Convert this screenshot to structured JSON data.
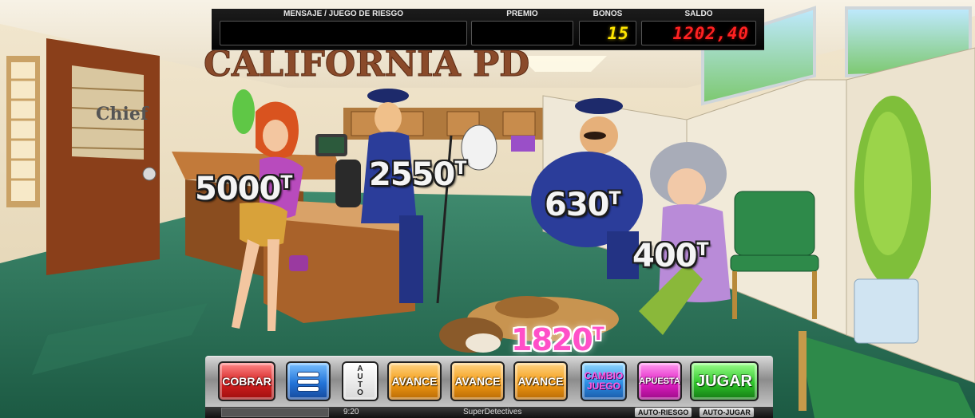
{
  "hud": {
    "mensaje_label": "MENSAJE / JUEGO DE RIESGO",
    "premio_label": "PREMIO",
    "bonos_label": "BONOS",
    "saldo_label": "SALDO",
    "bonos_value": "15",
    "saldo_value": "1202,40"
  },
  "scene": {
    "sign": "CALIFORNIA PD",
    "door_sign": "Chief"
  },
  "prizes": {
    "woman": "5000",
    "officer": "2550",
    "fat_officer": "630",
    "grandma": "400",
    "dog": "1820",
    "unit": "T"
  },
  "controls": {
    "cobrar": "COBRAR",
    "auto_letters": [
      "A",
      "U",
      "T",
      "O"
    ],
    "avance": "AVANCE",
    "cambio_line1": "CAMBIO",
    "cambio_line2": "JUEGO",
    "apuesta": "APUESTA",
    "jugar": "JUGAR",
    "menu_icon": "hamburger-menu-icon"
  },
  "status": {
    "clock": "9:20",
    "game_name": "SuperDetectives",
    "auto_riesgo": "AUTO-RIESGO",
    "auto_jugar": "AUTO-JUGAR"
  },
  "colors": {
    "bonos": "#ffe600",
    "saldo": "#ff2222",
    "dog_prize": "#ff4fc8"
  }
}
